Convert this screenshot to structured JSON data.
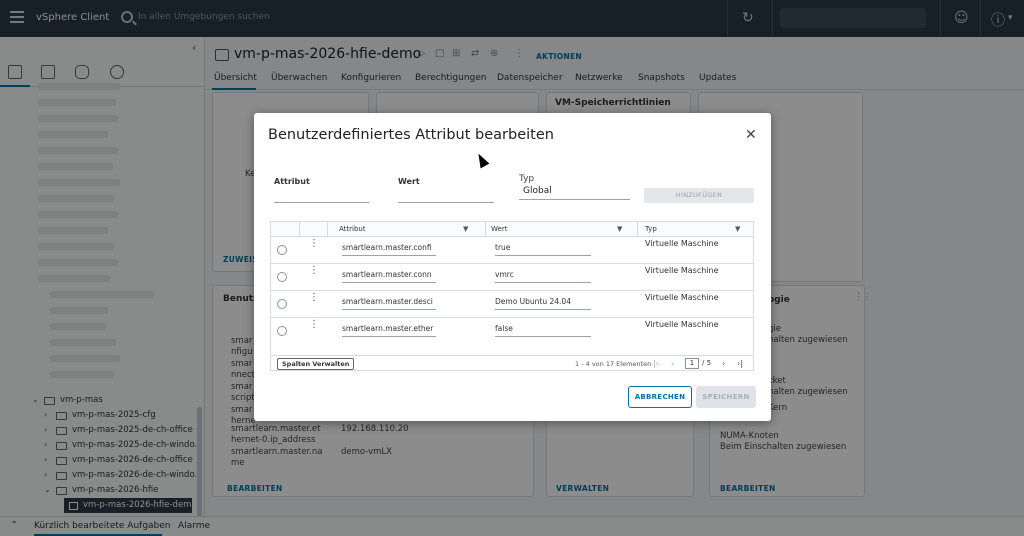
{
  "topbar": {
    "brand": "vSphere Client",
    "search_placeholder": "In allen Umgebungen suchen"
  },
  "tree": {
    "items": [
      {
        "label": "vm-p-mas",
        "expanded": true
      },
      {
        "label": "vm-p-mas-2025-cfg"
      },
      {
        "label": "vm-p-mas-2025-de-ch-office"
      },
      {
        "label": "vm-p-mas-2025-de-ch-windo..."
      },
      {
        "label": "vm-p-mas-2026-de-ch-office"
      },
      {
        "label": "vm-p-mas-2026-de-ch-windo..."
      },
      {
        "label": "vm-p-mas-2026-hfie",
        "expanded": true
      },
      {
        "label": "vm-p-mas-2026-hfie-demo",
        "selected": true
      }
    ]
  },
  "bottombar": {
    "tab_recent": "Kürzlich bearbeitete Aufgaben",
    "tab_alarms": "Alarme"
  },
  "vm": {
    "title": "vm-p-mas-2026-hfie-demo",
    "actions_label": "AKTIONEN"
  },
  "tabs": [
    "Übersicht",
    "Überwachen",
    "Konfigurieren",
    "Berechtigungen",
    "Datenspeicher",
    "Netzwerke",
    "Snapshots",
    "Updates"
  ],
  "background": {
    "vm_policies_title": "VM-Speicherrichtlinien",
    "card_left_link": "ZUWEIS",
    "card_left_partial": "Ke",
    "card_attr_title": "Benutz",
    "card_topo_title": "ogie",
    "attr_rows": [
      {
        "name_lines": [
          "smar",
          "nfigu"
        ],
        "value": ""
      },
      {
        "name_lines": [
          "smar",
          "nnect"
        ],
        "value": ""
      },
      {
        "name_lines": [
          "smar",
          "script"
        ],
        "value": ""
      },
      {
        "name_lines": [
          "smar",
          "herne"
        ],
        "value": ""
      },
      {
        "name_lines": [
          "smartlearn.master.et",
          "hernet-0.ip_address"
        ],
        "value": "192.168.110.20"
      },
      {
        "name_lines": [
          "smartlearn.master.na",
          "me"
        ],
        "value": "demo-vmLX"
      }
    ],
    "topo_lines": [
      {
        "l1": "gie",
        "l2": "halten zugewiesen"
      },
      {
        "l1": "cket",
        "l2": "halten zugewiesen"
      },
      {
        "l1": "Kern",
        "l2": ""
      },
      {
        "l1": "NUMA-Knoten",
        "l2": "Beim Einschalten zugewiesen"
      }
    ],
    "link_bearbeiten_1": "BEARBEITEN",
    "link_verwalten": "VERWALTEN",
    "link_bearbeiten_2": "BEARBEITEN"
  },
  "dialog": {
    "title": "Benutzerdefiniertes Attribut bearbeiten",
    "attribut_label": "Attribut",
    "wert_label": "Wert",
    "typ_label": "Typ",
    "typ_value": "Global",
    "add_button": "HINZUFÜGEN",
    "grid": {
      "columns": [
        "Attribut",
        "Wert",
        "Typ"
      ],
      "rows": [
        {
          "attribut": "smartlearn.master.confi",
          "wert": "true",
          "typ": "Virtuelle Maschine"
        },
        {
          "attribut": "smartlearn.master.conn",
          "wert": "vmrc",
          "typ": "Virtuelle Maschine"
        },
        {
          "attribut": "smartlearn.master.desci",
          "wert": "Demo Ubuntu 24.04",
          "typ": "Virtuelle Maschine"
        },
        {
          "attribut": "smartlearn.master.ether",
          "wert": "false",
          "typ": "Virtuelle Maschine"
        }
      ],
      "manage_columns": "Spalten Verwalten",
      "count": "1 - 4 von 17 Elementen",
      "page": "1",
      "page_total": "/ 5"
    },
    "cancel_button": "ABBRECHEN",
    "save_button": "SPEICHERN"
  }
}
